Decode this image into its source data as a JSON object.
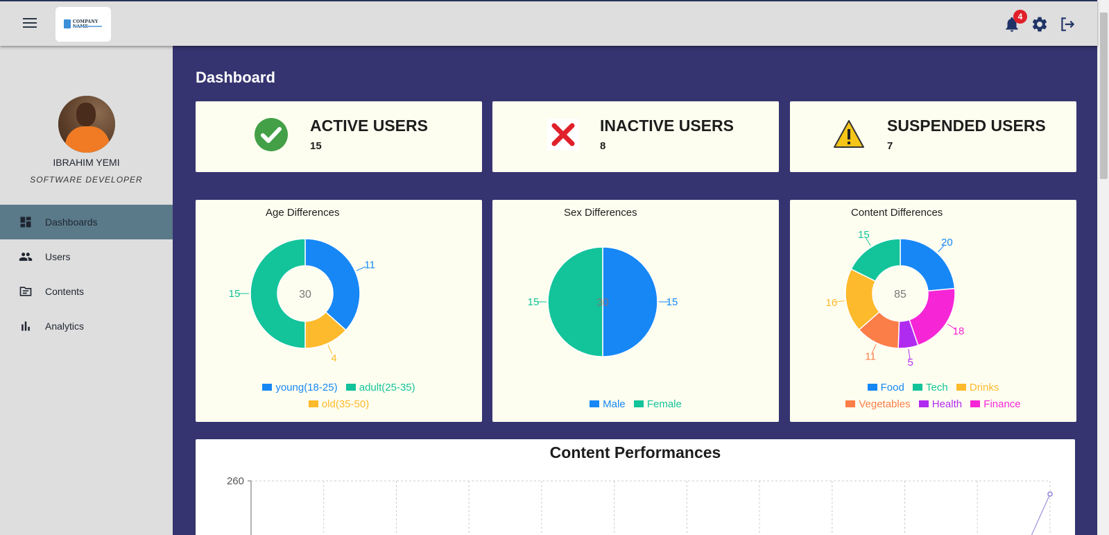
{
  "topbar": {
    "logo": {
      "text": "COMPANY NAME"
    },
    "notifications": {
      "count": "4"
    },
    "icons": [
      "menu-icon",
      "bell-icon",
      "gear-icon",
      "logout-icon"
    ]
  },
  "sidebar": {
    "user": {
      "name": "IBRAHIM YEMI",
      "role": "SOFTWARE DEVELOPER"
    },
    "items": [
      {
        "label": "Dashboards",
        "icon": "dashboard-icon",
        "active": true
      },
      {
        "label": "Users",
        "icon": "users-icon",
        "active": false
      },
      {
        "label": "Contents",
        "icon": "folder-icon",
        "active": false
      },
      {
        "label": "Analytics",
        "icon": "bar-chart-icon",
        "active": false
      }
    ]
  },
  "main": {
    "title": "Dashboard",
    "stats": [
      {
        "title": "ACTIVE USERS",
        "value": "15",
        "icon": "check-circle-icon",
        "color": "#43a047"
      },
      {
        "title": "INACTIVE USERS",
        "value": "8",
        "icon": "cross-icon",
        "color": "#e0202a"
      },
      {
        "title": "SUSPENDED USERS",
        "value": "7",
        "icon": "warning-icon",
        "color": "#f5c518"
      }
    ]
  },
  "colors": {
    "page_bg": "#353470",
    "card_bg": "#fefef0",
    "blue": "#1787f5",
    "green": "#13c39a",
    "yellow": "#fdba2c",
    "orange": "#fb7d48",
    "purple": "#b02bf0",
    "magenta": "#f626d6"
  },
  "chart_data": [
    {
      "type": "donut",
      "title": "Age Differences",
      "center_label": "30",
      "series": [
        {
          "name": "young(18-25)",
          "value": 11,
          "color": "#1787f5"
        },
        {
          "name": "old(35-50)",
          "value": 4,
          "color": "#fdba2c"
        },
        {
          "name": "adult(25-35)",
          "value": 15,
          "color": "#13c39a"
        }
      ],
      "legend": [
        {
          "name": "young(18-25)",
          "color": "#1787f5"
        },
        {
          "name": "adult(25-35)",
          "color": "#13c39a"
        },
        {
          "name": "old(35-50)",
          "color": "#fdba2c"
        }
      ]
    },
    {
      "type": "pie",
      "title": "Sex Differences",
      "center_label": "30",
      "series": [
        {
          "name": "Male",
          "value": 15,
          "color": "#1787f5"
        },
        {
          "name": "Female",
          "value": 15,
          "color": "#13c39a"
        }
      ],
      "legend": [
        {
          "name": "Male",
          "color": "#1787f5"
        },
        {
          "name": "Female",
          "color": "#13c39a"
        }
      ]
    },
    {
      "type": "donut",
      "title": "Content Differences",
      "center_label": "85",
      "series": [
        {
          "name": "Food",
          "value": 20,
          "color": "#1787f5"
        },
        {
          "name": "Finance",
          "value": 18,
          "color": "#f626d6"
        },
        {
          "name": "Health",
          "value": 5,
          "color": "#b02bf0"
        },
        {
          "name": "Vegetables",
          "value": 11,
          "color": "#fb7d48"
        },
        {
          "name": "Drinks",
          "value": 16,
          "color": "#fdba2c"
        },
        {
          "name": "Tech",
          "value": 15,
          "color": "#13c39a"
        }
      ],
      "legend": [
        {
          "name": "Food",
          "color": "#1787f5"
        },
        {
          "name": "Tech",
          "color": "#13c39a"
        },
        {
          "name": "Drinks",
          "color": "#fdba2c"
        },
        {
          "name": "Vegetables",
          "color": "#fb7d48"
        },
        {
          "name": "Health",
          "color": "#b02bf0"
        },
        {
          "name": "Finance",
          "color": "#f626d6"
        }
      ]
    },
    {
      "type": "line",
      "title": "Content Performances",
      "y_ticks": [
        "260"
      ],
      "grid": true,
      "series_color": "#8a7fd6",
      "visible_points": [
        {
          "index": 11,
          "value": 260
        }
      ]
    }
  ]
}
